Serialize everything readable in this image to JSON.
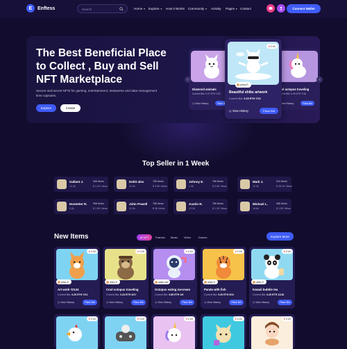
{
  "header": {
    "brand": "Enftess",
    "search_placeholder": "Search",
    "nav": [
      "Home",
      "Explore",
      "How it Works",
      "Community",
      "Activity",
      "Pages",
      "Contact"
    ],
    "connect_label": "Connect Wallet"
  },
  "hero": {
    "title": "The Best Beneficial Place to Collect , Buy and Sell NFT Marketplace",
    "description": "Secure and secret NFTs for gaming, entertainment, metaverse and data management time capsules.",
    "explore_label": "Explore",
    "create_label": "Create",
    "featured": {
      "owner": "johny E.",
      "likes": "2.1K",
      "title": "Beautiful shibs artwork",
      "bid_label": "Current Bid:",
      "bid_value": "0.29 ETH 7/21",
      "view_label": "View History",
      "place_label": "Place Bid"
    },
    "left_card": {
      "title": "Diamond animals",
      "bid_label": "Current Bid:",
      "bid_value": "0.27 ETH 7/21",
      "view_label": "View History",
      "place_label": "Place Bid"
    },
    "right_card": {
      "title": "Cool octopus traveling",
      "bid_label": "Current Bid:",
      "bid_value": "0.43 ETH 7/16",
      "view_label": "View History",
      "place_label": "Place Bid"
    }
  },
  "top_seller": {
    "title": "Top Seller in 1 Week",
    "sellers": [
      {
        "name": "Gallant J.",
        "eth": "12.3k",
        "items": "546 Items",
        "usd": "$ 1.1K Views"
      },
      {
        "name": "Debit alex",
        "eth": "12.3k",
        "items": "789 Items",
        "usd": "$ 3.5K Views"
      },
      {
        "name": "Johnny E.",
        "eth": "1.3k",
        "items": "789 Items",
        "usd": "$ 3.5K Views"
      },
      {
        "name": "Mark J.",
        "eth": "12.3k",
        "items": "324 Items",
        "usd": "$ 28.1K Views"
      },
      {
        "name": "Hostetter R.",
        "eth": "0.2k",
        "items": "998 Items",
        "usd": "$ 1.5K Views"
      },
      {
        "name": "John Powell",
        "eth": "12.3k",
        "items": "756 Items",
        "usd": "$ 36 Views"
      },
      {
        "name": "Austin R.",
        "eth": "12.3k",
        "items": "789 Items",
        "usd": "$ 1.2K Views"
      },
      {
        "name": "Michael L.",
        "eth": "18.6k",
        "items": "456 Items",
        "usd": "$ 1.5K Views"
      }
    ]
  },
  "new_items": {
    "title": "New Items",
    "filters": [
      "All NFT",
      "Fashion",
      "Music",
      "Video",
      "Games"
    ],
    "explore_more": "Explore More",
    "cards": [
      {
        "title": "Art work #2134",
        "owner": "johny E.",
        "likes": "2.1K",
        "bid_label": "Current Bid:",
        "bid": "0.20 ETH 7/21",
        "view": "View History",
        "place": "Place Bid"
      },
      {
        "title": "Cool octopus traveling",
        "owner": "johny E.",
        "likes": "2.1K",
        "bid_label": "Current Bid:",
        "bid": "0.24 ETH 4/17",
        "view": "View History",
        "place": "Place Bid"
      },
      {
        "title": "Octopus eating icecream",
        "owner": "adam das",
        "likes": "2.1K",
        "bid_label": "Current Bid:",
        "bid": "0.89 ETH 1/6",
        "view": "View History",
        "place": "Place Bid"
      },
      {
        "title": "Panda with fish",
        "owner": "johny E.",
        "likes": "2.1K",
        "bid_label": "Current Bid:",
        "bid": "0.20 ETH 5/11",
        "view": "View History",
        "place": "Place Bid"
      },
      {
        "title": "Kawaii bubble tea",
        "owner": "johny E.",
        "likes": "2.1K",
        "bid_label": "Current Bid:",
        "bid": "0.20 ETH 11/18",
        "view": "View History",
        "place": "Place Bid"
      }
    ],
    "row2_likes": [
      "2.1K",
      "2.1K",
      "2.1K",
      "2.1K",
      "2.1K"
    ]
  }
}
